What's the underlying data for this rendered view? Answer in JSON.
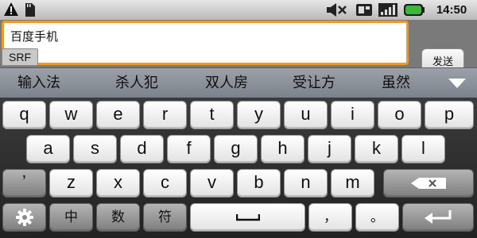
{
  "status_bar": {
    "time": "14:50",
    "icons": [
      "warning-icon",
      "sd-card-icon",
      "mute-icon",
      "sim-icon",
      "signal-icon",
      "battery-icon"
    ],
    "battery_color": "#3bb83b"
  },
  "input": {
    "value": "百度手机",
    "mode_badge": "SRF",
    "send_label": "发送",
    "focus_color": "#f29a1f"
  },
  "candidates": [
    "输入法",
    "杀人犯",
    "双人房",
    "受让方",
    "虽然"
  ],
  "keyboard": {
    "row1": [
      "q",
      "w",
      "e",
      "r",
      "t",
      "y",
      "u",
      "i",
      "o",
      "p"
    ],
    "row2": [
      "a",
      "s",
      "d",
      "f",
      "g",
      "h",
      "j",
      "k",
      "l"
    ],
    "row3": [
      "ʼ",
      "z",
      "x",
      "c",
      "v",
      "b",
      "n",
      "m"
    ],
    "row4": {
      "settings_icon": "gear-icon",
      "chinese": "中",
      "numbers": "数",
      "symbols": "符",
      "space_icon": "space-icon",
      "comma": "，",
      "period": "。",
      "enter_icon": "enter-icon",
      "delete_icon": "backspace-icon"
    }
  }
}
